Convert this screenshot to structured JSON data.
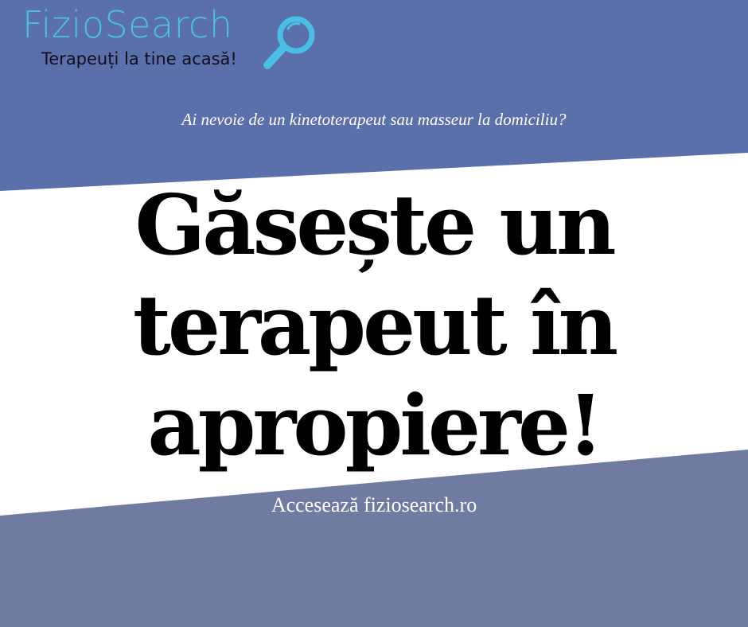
{
  "colors": {
    "top_band": "#5b70ab",
    "bottom_band": "#6f7ba1",
    "middle_band": "#ffffff",
    "logo_blue": "#49bfe6"
  },
  "logo": {
    "wordmark": "FizioSearch",
    "tagline": "Terapeuți la tine acasă!",
    "icon": "magnifying-glass-icon"
  },
  "subtitle": "Ai nevoie de un kinetoterapeut sau masseur la domiciliu?",
  "headline": {
    "line1": "Găsește un",
    "line2": "terapeut în",
    "line3": "apropiere!"
  },
  "cta": "Accesează fiziosearch.ro"
}
